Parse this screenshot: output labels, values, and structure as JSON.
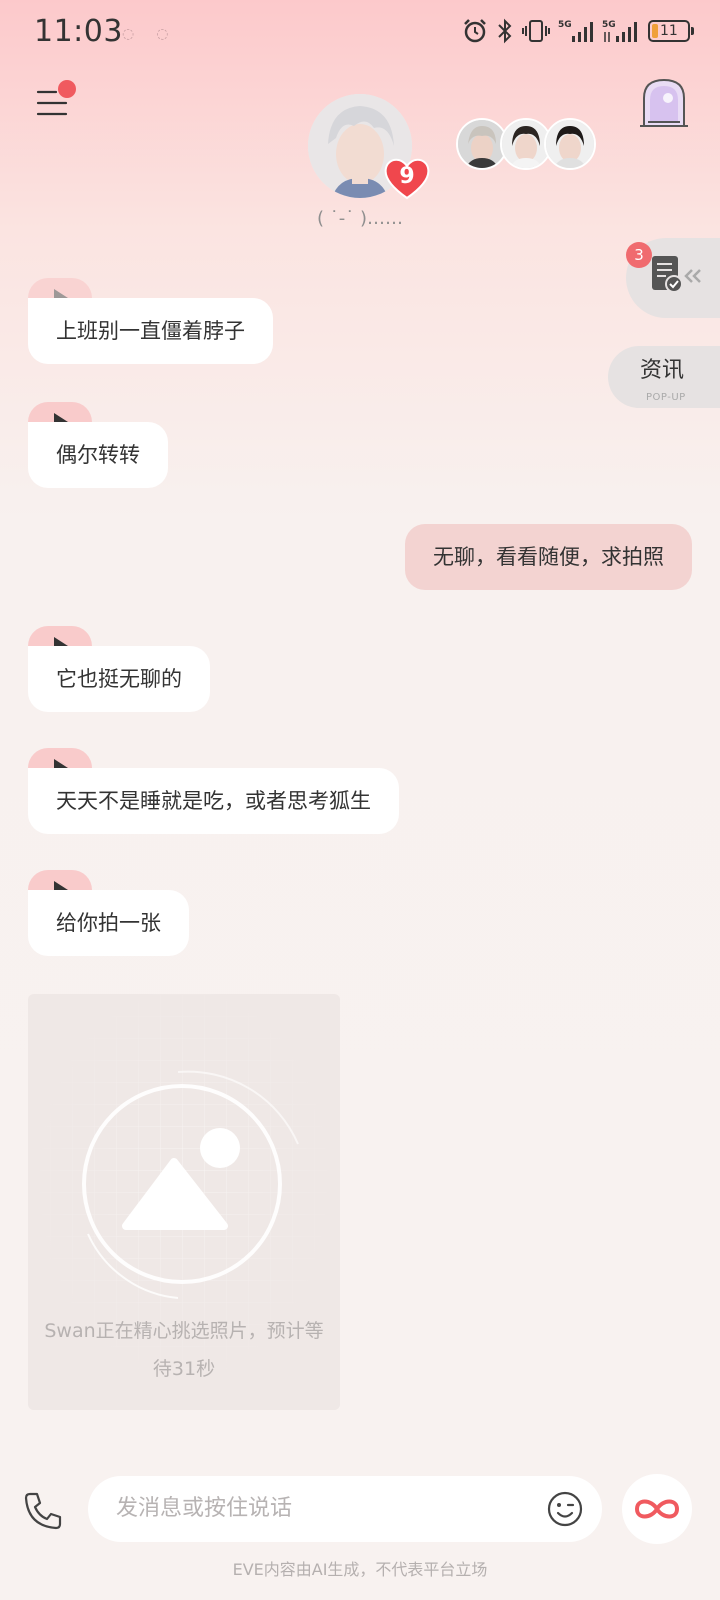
{
  "status_bar": {
    "time": "11:03",
    "battery": "11",
    "network_1": "5G",
    "network_2": "5G"
  },
  "header": {
    "affection_level": "9",
    "mood": "( ˙-˙ )……"
  },
  "side_tabs": {
    "task_count": "3",
    "news_label": "资讯",
    "news_sub": "POP-UP"
  },
  "messages": [
    {
      "from": "ai",
      "text": "上班别一直僵着脖子"
    },
    {
      "from": "ai",
      "text": "偶尔转转"
    },
    {
      "from": "user",
      "text": "无聊，看看随便，求拍照"
    },
    {
      "from": "ai",
      "text": "它也挺无聊的"
    },
    {
      "from": "ai",
      "text": "天天不是睡就是吃，或者思考狐生"
    },
    {
      "from": "ai",
      "text": "给你拍一张"
    }
  ],
  "photo_card": {
    "status": "Swan正在精心挑选照片，预计等待31秒"
  },
  "input": {
    "placeholder": "发消息或按住说话"
  },
  "footer": {
    "disclaimer": "EVE内容由AI生成，不代表平台立场"
  },
  "colors": {
    "accent": "#f05a5f",
    "voice_tag": "#f9cbcb",
    "user_bubble": "#f3d3d1",
    "ai_bubble": "#ffffff"
  }
}
